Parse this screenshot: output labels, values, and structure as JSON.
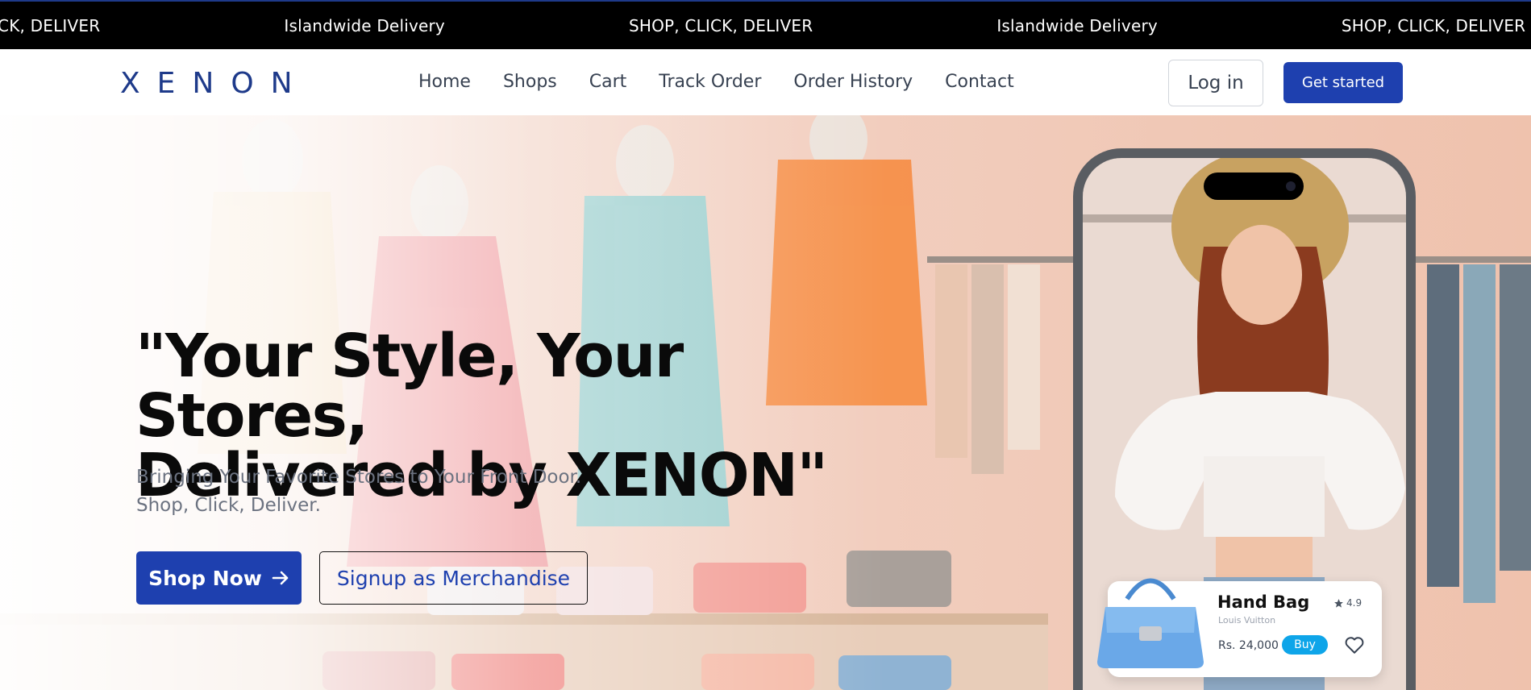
{
  "marquee": {
    "items": [
      "SHOP, CLICK, DELIVER",
      "Islandwide Delivery",
      "SHOP, CLICK, DELIVER",
      "Islandwide Delivery",
      "SHOP, CLICK, DELIVER"
    ]
  },
  "nav": {
    "logo": "XENON",
    "links": [
      "Home",
      "Shops",
      "Cart",
      "Track Order",
      "Order History",
      "Contact"
    ],
    "login_label": "Log in",
    "get_started_label": "Get started"
  },
  "hero": {
    "headline_line1": "\"Your Style, Your Stores,",
    "headline_line2": "Delivered by XENON\"",
    "subtitle_line1": "Bringing Your Favorite Stores to Your Front Door.",
    "subtitle_line2": "Shop, Click, Deliver.",
    "shop_now_label": "Shop Now",
    "shop_now_icon": "arrow-right-icon",
    "signup_label": "Signup as Merchandise"
  },
  "product_card": {
    "name": "Hand Bag",
    "brand": "Louis Vuitton",
    "rating": "4.9",
    "price": "Rs. 24,000",
    "buy_label": "Buy",
    "rating_icon": "star-icon",
    "favorite_icon": "heart-icon"
  },
  "colors": {
    "brand_blue": "#1e40af",
    "logo_blue": "#1e3a8a",
    "buy_blue": "#0ea5e9",
    "marquee_bg": "#000000"
  }
}
